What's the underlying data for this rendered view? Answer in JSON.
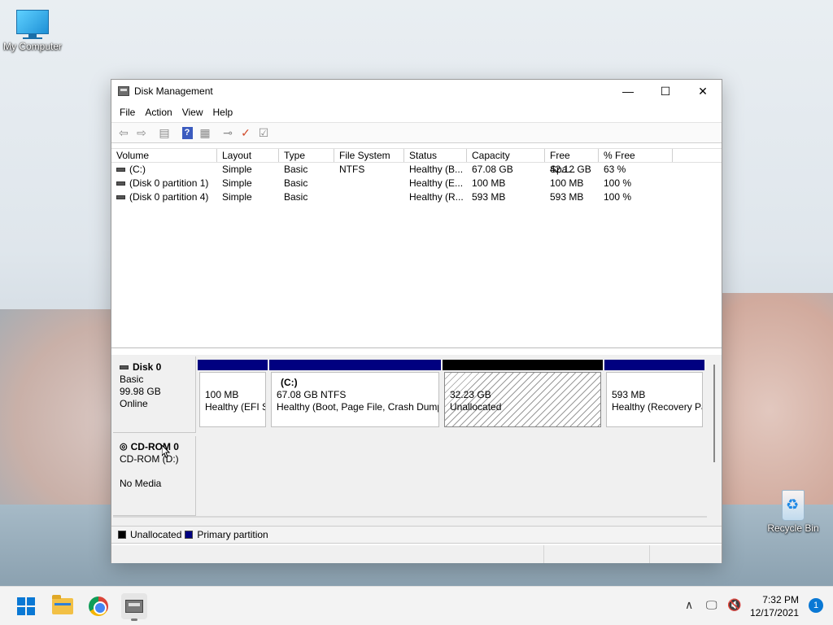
{
  "desktop": {
    "icons": [
      {
        "label": "My Computer",
        "icon": "monitor-icon"
      },
      {
        "label": "Recycle Bin",
        "icon": "recycle-bin-icon"
      }
    ]
  },
  "window": {
    "title": "Disk Management",
    "controls": {
      "minimize": "—",
      "maximize": "☐",
      "close": "✕"
    },
    "menu": [
      "File",
      "Action",
      "View",
      "Help"
    ],
    "toolbar": [
      "back-arrow-icon",
      "forward-arrow-icon",
      "properties-icon",
      "help-icon",
      "snap-in-icon",
      "connect-icon",
      "check-icon",
      "settings-icon"
    ],
    "toolbar_help_glyph": "?",
    "volume_list": {
      "columns": [
        "Volume",
        "Layout",
        "Type",
        "File System",
        "Status",
        "Capacity",
        "Free Spa...",
        "% Free"
      ],
      "rows": [
        [
          "(C:)",
          "Simple",
          "Basic",
          "NTFS",
          "Healthy (B...",
          "67.08 GB",
          "42.12 GB",
          "63 %"
        ],
        [
          "(Disk 0 partition 1)",
          "Simple",
          "Basic",
          "",
          "Healthy (E...",
          "100 MB",
          "100 MB",
          "100 %"
        ],
        [
          "(Disk 0 partition 4)",
          "Simple",
          "Basic",
          "",
          "Healthy (R...",
          "593 MB",
          "593 MB",
          "100 %"
        ]
      ]
    },
    "disks": {
      "disk0": {
        "name": "Disk 0",
        "type": "Basic",
        "size": "99.98 GB",
        "status": "Online",
        "partitions": [
          {
            "title": "",
            "size": "100 MB",
            "status": "Healthy (EFI S",
            "kind": "primary"
          },
          {
            "title": "(C:)",
            "size": "67.08 GB NTFS",
            "status": "Healthy (Boot, Page File, Crash Dump",
            "kind": "primary"
          },
          {
            "title": "",
            "size": "32.23 GB",
            "status": "Unallocated",
            "kind": "unallocated"
          },
          {
            "title": "",
            "size": "593 MB",
            "status": "Healthy (Recovery Pa",
            "kind": "primary"
          }
        ]
      },
      "cdrom0": {
        "name": "CD-ROM 0",
        "line2": "CD-ROM (D:)",
        "line3": "No Media"
      }
    },
    "legend": [
      {
        "label": "Unallocated",
        "color": "#000000"
      },
      {
        "label": "Primary partition",
        "color": "#000080"
      }
    ]
  },
  "taskbar": {
    "apps": [
      "windows-start-icon",
      "file-explorer-icon",
      "chrome-icon",
      "disk-management-icon"
    ],
    "tray": {
      "chevron": "∧",
      "time": "7:32 PM",
      "date": "12/17/2021",
      "notification_count": "1"
    }
  },
  "colors": {
    "primary_partition": "#000080",
    "unallocated": "#000000",
    "accent": "#0a78d4"
  }
}
